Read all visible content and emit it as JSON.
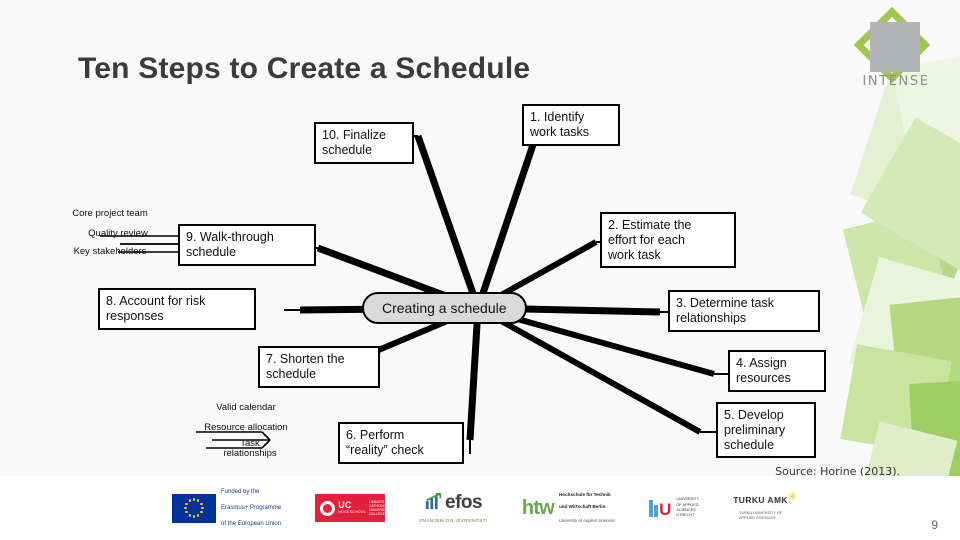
{
  "slide": {
    "title": "Ten Steps to Create a Schedule",
    "source": "Source: Horine (2013).",
    "page_number": "9",
    "background_color": "#f9f9f9"
  },
  "brand": {
    "name": "INTENSE",
    "square_color": "#b1b3b5",
    "diamond_color": "#9ac24a"
  },
  "mindmap": {
    "center": "Creating a schedule",
    "nodes": [
      {
        "id": "n1",
        "label": "1. Identify\nwork tasks"
      },
      {
        "id": "n2",
        "label": "2. Estimate the\neffort for each\nwork task"
      },
      {
        "id": "n3",
        "label": "3. Determine task\nrelationships"
      },
      {
        "id": "n4",
        "label": "4. Assign\nresources"
      },
      {
        "id": "n5",
        "label": "5. Develop\npreliminary\nschedule"
      },
      {
        "id": "n6",
        "label": "6. Perform\n“reality” check"
      },
      {
        "id": "n7",
        "label": "7. Shorten the\nschedule"
      },
      {
        "id": "n8",
        "label": "8. Account for risk\nresponses"
      },
      {
        "id": "n9",
        "label": "9. Walk-through\nschedule"
      },
      {
        "id": "n10",
        "label": "10. Finalize\nschedule"
      }
    ],
    "subleaves_step9": [
      "Core project team",
      "Quality review",
      "Key stakeholders"
    ],
    "subleaves_step6": [
      "Valid calendar",
      "Resource allocation",
      "Task\nrelationships"
    ]
  },
  "footer": {
    "eu": {
      "line1": "Funded by the",
      "line2": "Erasmus+ Programme",
      "line3": "of the European Union",
      "flag_color": "#003399",
      "star_color": "#ffcc00"
    },
    "uc": {
      "main": "UC",
      "sub": "HOGESCHOOL",
      "side": "LIMBURG\nCATHOLIC\nUNIVERSITY\nCOLLEGE",
      "color": "#e2203c"
    },
    "efos": {
      "word": "efos",
      "tagline": "ZNANJEM DO IZVRSNOSTI"
    },
    "htw": {
      "word": "htw",
      "line1": "Hochschule für Technik",
      "line2": "und Wirtschaft Berlin",
      "italic": "University of Applied Sciences"
    },
    "hu": {
      "letter": "U",
      "text": "UNIVERSITY\nOF APPLIED\nSCIENCES\nUTRECHT"
    },
    "turku": {
      "main": "TURKU AMK",
      "sub": "TURKU UNIVERSITY OF\nAPPLIED SCIENCES"
    }
  }
}
